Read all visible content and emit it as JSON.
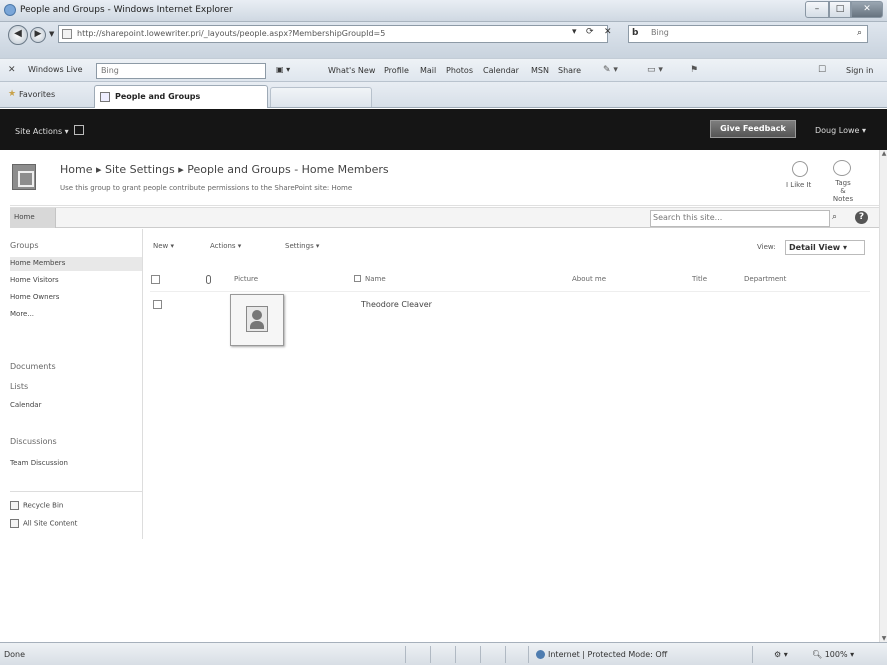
{
  "browser": {
    "title": "People and Groups - Windows Internet Explorer",
    "address": "http://sharepoint.lowewriter.pri/_layouts/people.aspx?MembershipGroupId=5",
    "search_placeholder": "Bing",
    "search_engine_logo": "b",
    "windows_live_label": "Windows Live",
    "windows_live_search": "Bing",
    "windows_live_links": [
      "What's New",
      "Profile",
      "Mail",
      "Photos",
      "Calendar",
      "MSN",
      "Share"
    ],
    "sign_in": "Sign in",
    "favorites_label": "Favorites",
    "tab_label": "People and Groups"
  },
  "sp": {
    "site_actions": "Site Actions ▾",
    "feedback": "Give Feedback",
    "user": "Doug Lowe ▾",
    "breadcrumb": "Home ▸ Site Settings ▸ People and Groups - Home Members",
    "description": "Use this group to grant people contribute permissions to the SharePoint site: Home",
    "i_like_it": "I Like It",
    "tags_notes": "Tags & Notes",
    "home_tab": "Home",
    "site_search_placeholder": "Search this site..."
  },
  "leftnav": {
    "groups_heading": "Groups",
    "groups": [
      "Home Members",
      "Home Visitors",
      "Home Owners",
      "More..."
    ],
    "selected_group": "Home Members",
    "documents": "Documents",
    "lists": "Lists",
    "calendar": "Calendar",
    "discussions": "Discussions",
    "team_discussion": "Team Discussion",
    "recycle_bin": "Recycle Bin",
    "all_site_content": "All Site Content"
  },
  "toolbar": {
    "new": "New ▾",
    "actions": "Actions ▾",
    "settings": "Settings ▾",
    "view_label": "View:",
    "view_value": "Detail View ▾"
  },
  "table": {
    "columns": [
      "Picture",
      "Name",
      "About me",
      "Title",
      "Department"
    ],
    "rows": [
      {
        "name": "Theodore Cleaver"
      }
    ]
  },
  "status": {
    "left": "Done",
    "zone": "Internet | Protected Mode: Off",
    "zoom": "100%"
  }
}
